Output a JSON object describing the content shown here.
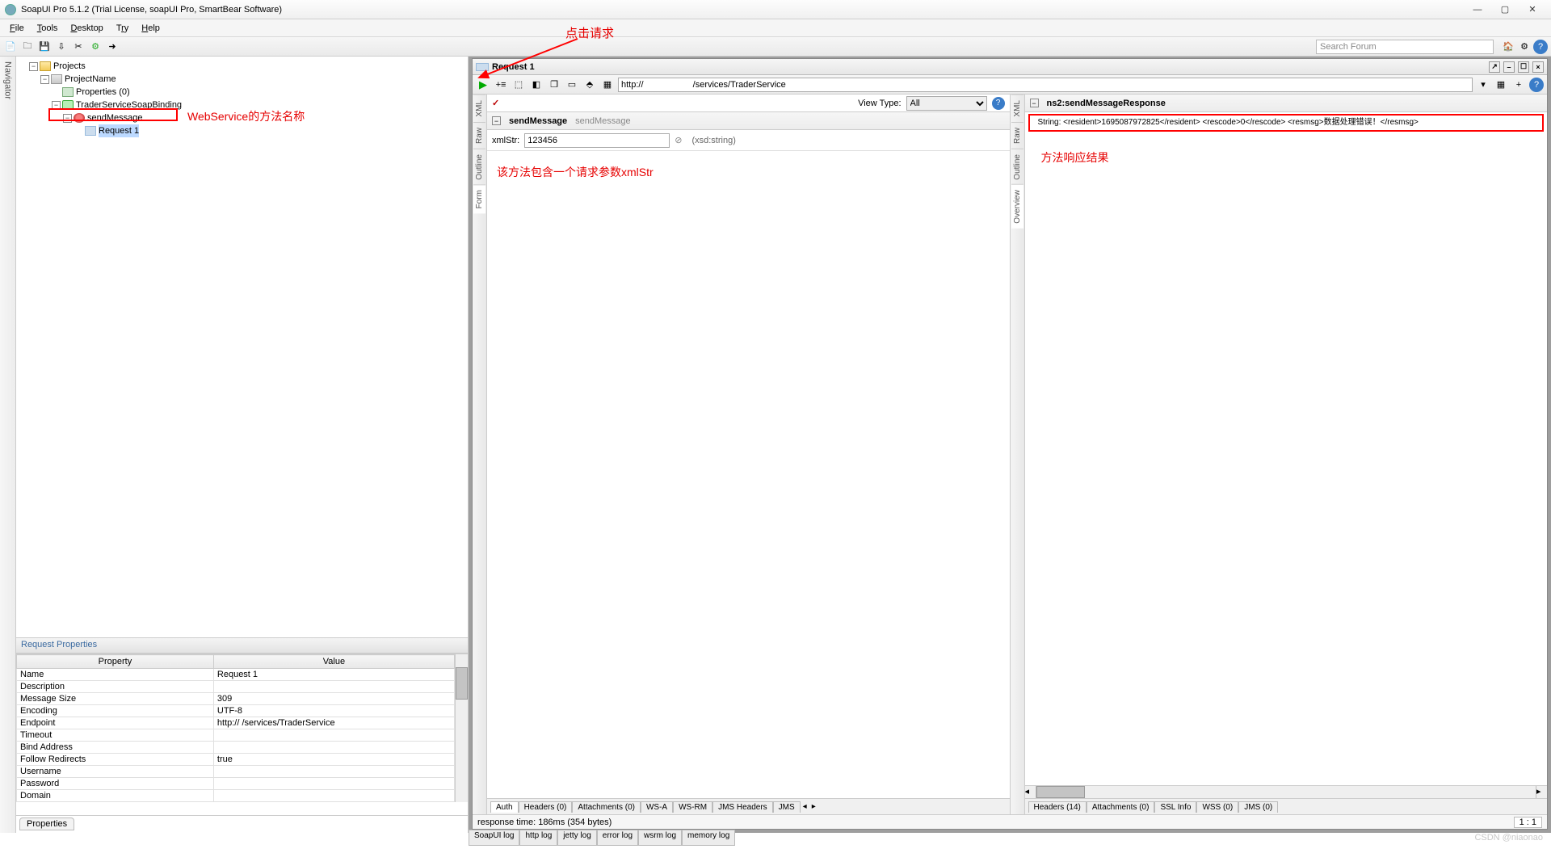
{
  "window": {
    "title": "SoapUI Pro 5.1.2 (Trial License, soapUI Pro, SmartBear Software)"
  },
  "menu": {
    "file": "File",
    "tools": "Tools",
    "desktop": "Desktop",
    "try": "Try",
    "help": "Help"
  },
  "toolbar": {
    "search_placeholder": "Search Forum"
  },
  "navigator": {
    "tab": "Navigator"
  },
  "tree": {
    "root": "Projects",
    "project": "ProjectName",
    "properties": "Properties (0)",
    "binding": "TraderServiceSoapBinding",
    "operation": "sendMessage",
    "request": "Request 1"
  },
  "annotations": {
    "method_name": "WebService的方法名称",
    "click_request": "点击请求",
    "param_note": "该方法包含一个请求参数xmlStr",
    "response_note": "方法响应结果"
  },
  "req_props": {
    "header": "Request Properties",
    "col_prop": "Property",
    "col_val": "Value",
    "rows": [
      {
        "k": "Name",
        "v": "Request 1"
      },
      {
        "k": "Description",
        "v": ""
      },
      {
        "k": "Message Size",
        "v": "309"
      },
      {
        "k": "Encoding",
        "v": "UTF-8"
      },
      {
        "k": "Endpoint",
        "v": "http://                              /services/TraderService"
      },
      {
        "k": "Timeout",
        "v": ""
      },
      {
        "k": "Bind Address",
        "v": ""
      },
      {
        "k": "Follow Redirects",
        "v": "true"
      },
      {
        "k": "Username",
        "v": ""
      },
      {
        "k": "Password",
        "v": ""
      },
      {
        "k": "Domain",
        "v": ""
      }
    ],
    "tab": "Properties"
  },
  "reqwin": {
    "title": "Request 1",
    "url_prefix": "http://",
    "url_suffix": "/services/TraderService",
    "viewtype_label": "View Type:",
    "viewtype_value": "All",
    "vtabs_req": [
      "Form",
      "Outline",
      "Raw",
      "XML"
    ],
    "vtabs_res": [
      "Overview",
      "Outline",
      "Raw",
      "XML"
    ],
    "op_bold": "sendMessage",
    "op_grey": "sendMessage",
    "field_label": "xmlStr:",
    "field_value": "123456",
    "field_type": "(xsd:string)",
    "resp_title": "ns2:sendMessageResponse",
    "resp_body": "String:   <resident>1695087972825</resident> <rescode>0</rescode> <resmsg>数据处理错误！</resmsg>",
    "btabs_req": [
      "Auth",
      "Headers (0)",
      "Attachments (0)",
      "WS-A",
      "WS-RM",
      "JMS Headers",
      "JMS"
    ],
    "btabs_res": [
      "Headers (14)",
      "Attachments (0)",
      "SSL Info",
      "WSS (0)",
      "JMS (0)"
    ],
    "status": "response time: 186ms (354 bytes)",
    "ratio": "1 : 1"
  },
  "logs": [
    "SoapUI log",
    "http log",
    "jetty log",
    "error log",
    "wsrm log",
    "memory log"
  ],
  "watermark": "CSDN @niaonao"
}
